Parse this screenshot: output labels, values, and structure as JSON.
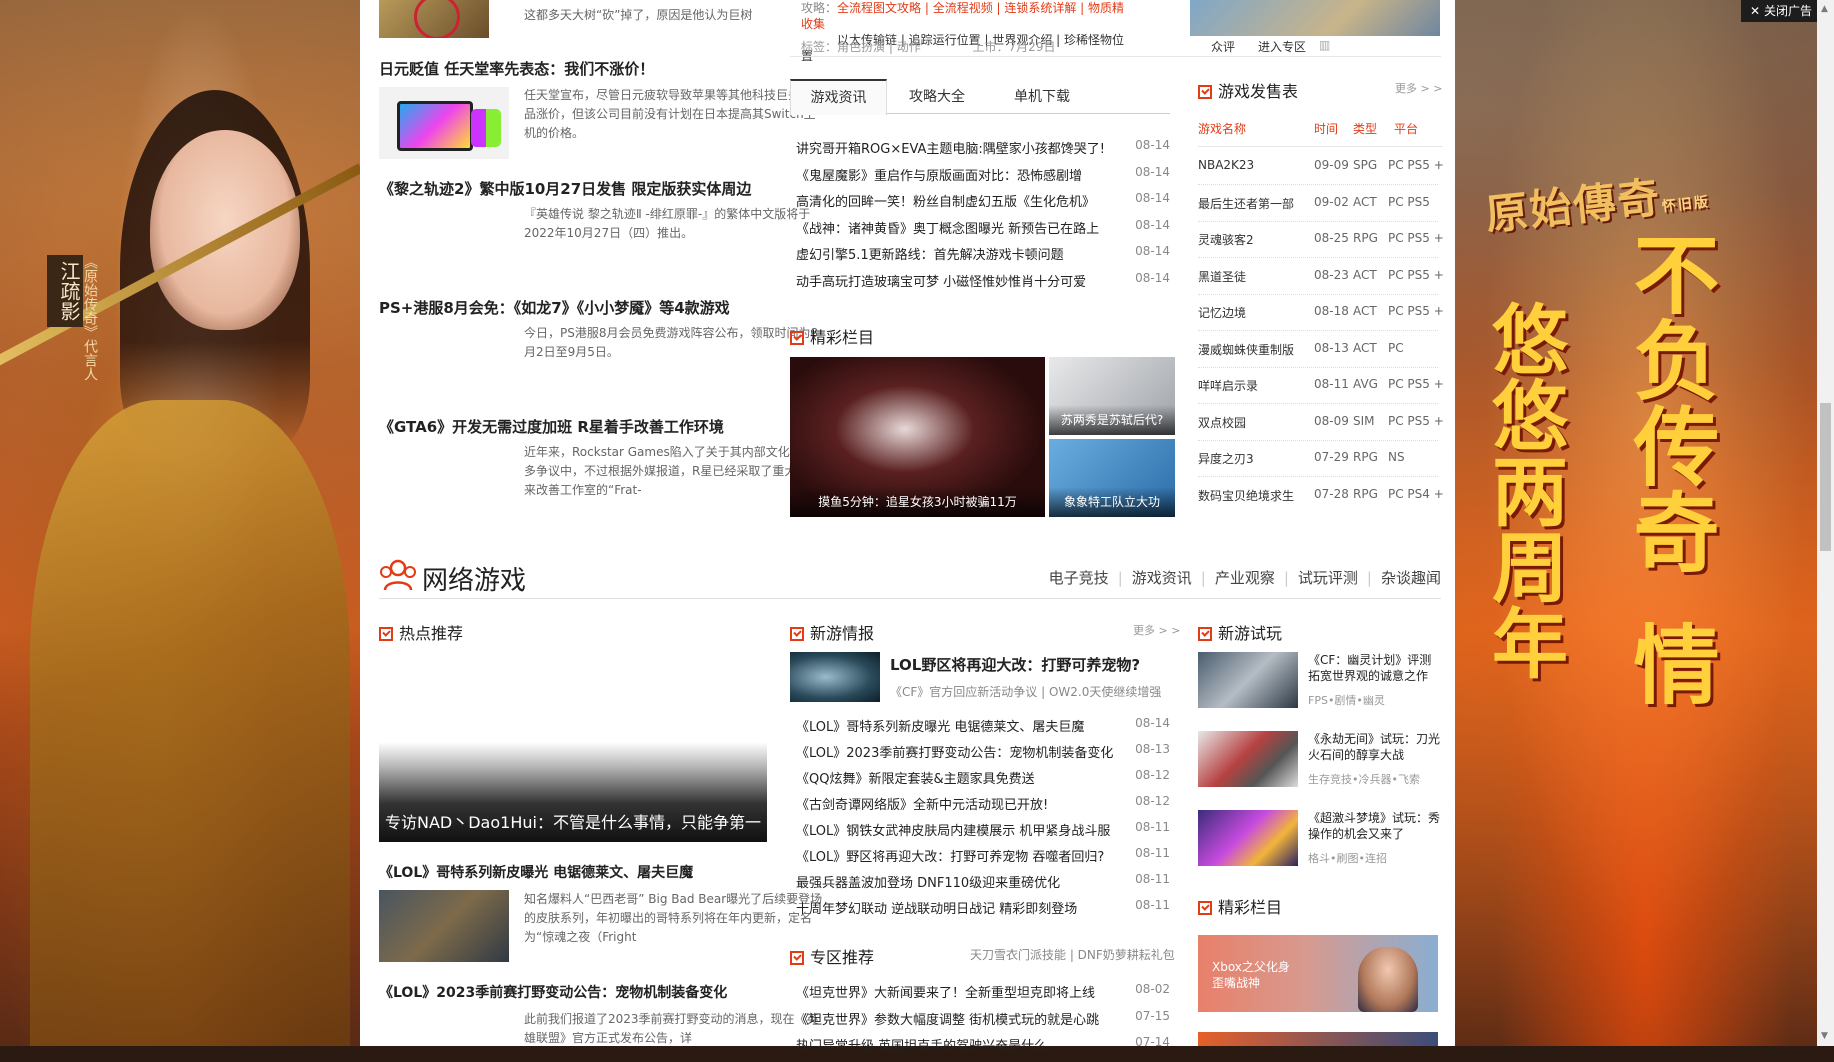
{
  "close_ad": "关闭广告",
  "left_ad": {
    "name": "江疏影",
    "slogan": "《原始传奇》代言人"
  },
  "right_ad": {
    "logo": "原始傳奇",
    "logo_sub": "怀旧版",
    "col1": "不负传奇",
    "col2": "情",
    "col3": "悠悠两周年"
  },
  "top_left_news": [
    {
      "title": "",
      "summary": "这都多天大树“砍”掉了，原因是他认为巨树"
    },
    {
      "title": "日元贬值 任天堂率先表态：我们不涨价！",
      "summary": "任天堂宣布，尽管日元疲软导致苹果等其他科技巨头的产品涨价，但该公司目前没有计划在日本提高其Switch主机的价格。"
    },
    {
      "title": "《黎之轨迹2》繁中版10月27日发售 限定版获实体周边",
      "summary": "『英雄传说 黎之轨迹Ⅱ -绯红原罪-』的繁体中文版将于2022年10月27日（四）推出。"
    },
    {
      "title": "PS+港服8月会免：《如龙7》《小小梦魇》等4款游戏",
      "summary": "今日，PS港服8月会员免费游戏阵容公布，领取时间为8月2日至9月5日。"
    },
    {
      "title": "《GTA6》开发无需过度加班 R星着手改善工作环境",
      "summary": "近年来，Rockstar Games陷入了关于其内部文化的诸多争议中，不过根据外媒报道，R星已经采取了重大措施来改善工作室的“Frat-"
    }
  ],
  "feature_card": {
    "guide_label": "攻略：",
    "guide_line1": "全流程图文攻略 | 全流程视频 | 连锁系统详解 | 物质精收集",
    "guide_line2": "以太传输链 | 追踪运行位置 | 世界观介绍 | 珍稀怪物位置",
    "tags_label": "标签：",
    "tags": "角色扮演 | 动作",
    "release_label": "上市：",
    "release": "7月29日",
    "score": "众评",
    "enter": "进入专区"
  },
  "tabs": [
    "游戏资讯",
    "攻略大全",
    "单机下载"
  ],
  "game_news": [
    {
      "title": "讲究哥开箱ROG×EVA主题电脑:隅壁家小孩都馋哭了!",
      "date": "08-14"
    },
    {
      "title": "《鬼屋魔影》重启作与原版画面对比：恐怖感剧增",
      "date": "08-14"
    },
    {
      "title": "高清化的回眸一笑！粉丝自制虚幻五版《生化危机》",
      "date": "08-14"
    },
    {
      "title": "《战神：诸神黄昏》奥丁概念图曝光 新预告已在路上",
      "date": "08-14"
    },
    {
      "title": "虚幻引擎5.1更新路线：首先解决游戏卡顿问题",
      "date": "08-14"
    },
    {
      "title": "动手高玩打造玻璃宝可梦 小磁怪惟妙惟肖十分可爱",
      "date": "08-14"
    }
  ],
  "featured_section": {
    "title": "精彩栏目",
    "big_caption": "摸鱼5分钟：追星女孩3小时被骗11万",
    "small_caption1": "苏两秀是苏轼后代?",
    "small_caption2": "象象特工队立大功"
  },
  "release_table": {
    "title": "游戏发售表",
    "more": "更多 > >",
    "headers": [
      "游戏名称",
      "时间",
      "类型",
      "平台"
    ],
    "rows": [
      [
        "NBA2K23",
        "09-09",
        "SPG",
        "PC PS5 +"
      ],
      [
        "最后生还者第一部",
        "09-02",
        "ACT",
        "PC PS5"
      ],
      [
        "灵魂骇客2",
        "08-25",
        "RPG",
        "PC PS5 +"
      ],
      [
        "黑道圣徒",
        "08-23",
        "ACT",
        "PC PS5 +"
      ],
      [
        "记忆边境",
        "08-18",
        "ACT",
        "PC PS5 +"
      ],
      [
        "漫威蜘蛛侠重制版",
        "08-13",
        "ACT",
        "PC"
      ],
      [
        "咩咩启示录",
        "08-11",
        "AVG",
        "PC PS5 +"
      ],
      [
        "双点校园",
        "08-09",
        "SIM",
        "PC PS5 +"
      ],
      [
        "异度之刃3",
        "07-29",
        "RPG",
        "NS"
      ],
      [
        "数码宝贝绝境求生",
        "07-28",
        "RPG",
        "PC PS4 +"
      ]
    ]
  },
  "online_section": {
    "title": "网络游戏",
    "nav": [
      "电子竞技",
      "游戏资讯",
      "产业观察",
      "试玩评测",
      "杂谈趣闻"
    ]
  },
  "hot": {
    "title": "热点推荐",
    "slide_caption": "专访NAD丶Dao1Hui：不管是什么事情，只能争第一",
    "items": [
      {
        "title": "《LOL》哥特系列新皮曝光 电锯德莱文、屠夫巨魔",
        "summary": "知名爆料人“巴西老哥” Big Bad Bear曝光了后续要登场的皮肤系列，年初曝出的哥特系列将在年内更新，定名为“惊魂之夜（Fright"
      },
      {
        "title": "《LOL》2023季前赛打野变动公告：宠物机制装备变化",
        "summary": "此前我们报道了2023季前赛打野变动的消息，现在《英雄联盟》官方正式发布公告，详"
      }
    ]
  },
  "new_games": {
    "title": "新游情报",
    "more": "更多 > >",
    "lead_title": "LOL野区将再迎大改：打野可养宠物?",
    "lead_sub": "《CF》官方回应新活动争议 | OW2.0天使继续增强",
    "items": [
      {
        "title": "《LOL》哥特系列新皮曝光 电锯德莱文、屠夫巨魔",
        "date": "08-14"
      },
      {
        "title": "《LOL》2023季前赛打野变动公告：宠物机制装备变化",
        "date": "08-13"
      },
      {
        "title": "《QQ炫舞》新限定套装&主题家具免费送",
        "date": "08-12"
      },
      {
        "title": "《古剑奇谭网络版》全新中元活动现已开放!",
        "date": "08-12"
      },
      {
        "title": "《LOL》钢铁女武神皮肤局内建模展示 机甲紧身战斗服",
        "date": "08-11"
      },
      {
        "title": "《LOL》野区将再迎大改：打野可养宠物 吞噬者回归?",
        "date": "08-11"
      },
      {
        "title": "最强兵器盖波加登场 DNF110级迎来重磅优化",
        "date": "08-11"
      },
      {
        "title": "十周年梦幻联动 逆战联动明日战记 精彩即刻登场",
        "date": "08-11"
      }
    ]
  },
  "zone": {
    "title": "专区推荐",
    "links": "天刀雪衣门派技能 | DNF奶萝耕耘礼包",
    "items": [
      {
        "title": "《坦克世界》大新闻要来了！全新重型坦克即将上线",
        "date": "08-02"
      },
      {
        "title": "《坦克世界》参数大幅度调整 街机模式玩的就是心跳",
        "date": "07-15"
      },
      {
        "title": "热门异常升级 英国坦克手的驾驶兴奋是什么",
        "date": "07-14"
      }
    ]
  },
  "trials": {
    "title": "新游试玩",
    "items": [
      {
        "title": "《CF：幽灵计划》评测 拓宽世界观的诚意之作",
        "tags": "FPS•剧情•幽灵"
      },
      {
        "title": "《永劫无间》试玩：刀光火石间的醇享大战",
        "tags": "生存竞技•冷兵器•飞索"
      },
      {
        "title": "《超激斗梦境》试玩：秀操作的机会又来了",
        "tags": "格斗•刷图•连招"
      }
    ]
  },
  "featured2": {
    "title": "精彩栏目",
    "banner": "Xbox之父化身 歪嘴战神"
  }
}
